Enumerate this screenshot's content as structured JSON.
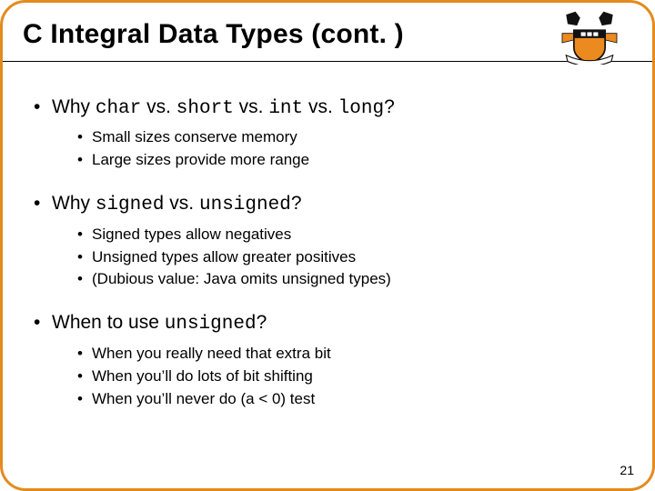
{
  "title": "C Integral Data Types (cont. )",
  "bullets": [
    {
      "q_prefix": "Why ",
      "q_kw": "char",
      "q_mid1": " vs. ",
      "q_kw2": "short",
      "q_mid2": " vs. ",
      "q_kw3": "int",
      "q_mid3": " vs. ",
      "q_kw4": "long",
      "q_suffix": "?",
      "sub": [
        "Small sizes conserve memory",
        "Large sizes provide more range"
      ]
    },
    {
      "q_prefix": "Why ",
      "q_kw": "signed",
      "q_mid1": " vs. ",
      "q_kw2": "unsigned",
      "q_suffix": "?",
      "sub": [
        "Signed types allow negatives",
        "Unsigned types allow greater positives",
        "(Dubious value:  Java omits unsigned types)"
      ]
    },
    {
      "q_prefix": "When to use ",
      "q_kw": "unsigned",
      "q_suffix": "?",
      "sub": [
        "When you really need that extra bit",
        "When you’ll do lots of bit shifting",
        "When you’ll never do (a < 0) test"
      ]
    }
  ],
  "page_number": "21",
  "logo": {
    "name": "princeton-shield"
  }
}
